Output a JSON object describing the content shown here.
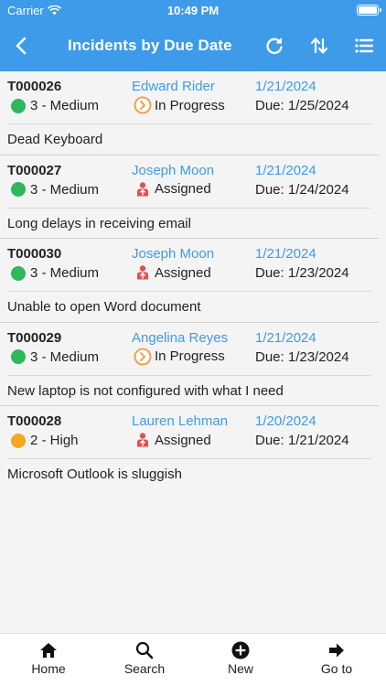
{
  "status": {
    "carrier": "Carrier",
    "time": "10:49 PM"
  },
  "header": {
    "title": "Incidents by Due Date"
  },
  "incidents": [
    {
      "number": "T000026",
      "person": "Edward Rider",
      "opened": "1/21/2024",
      "priority": "3 - Medium",
      "priority_color": "#2eb85c",
      "state": "In Progress",
      "state_icon": "progress-icon",
      "due": "Due: 1/25/2024",
      "description": "Dead Keyboard"
    },
    {
      "number": "T000027",
      "person": "Joseph Moon",
      "opened": "1/21/2024",
      "priority": "3 - Medium",
      "priority_color": "#2eb85c",
      "state": "Assigned",
      "state_icon": "assigned-icon",
      "due": "Due: 1/24/2024",
      "description": "Long delays in receiving email"
    },
    {
      "number": "T000030",
      "person": "Joseph Moon",
      "opened": "1/21/2024",
      "priority": "3 - Medium",
      "priority_color": "#2eb85c",
      "state": "Assigned",
      "state_icon": "assigned-icon",
      "due": "Due: 1/23/2024",
      "description": "Unable to open Word document"
    },
    {
      "number": "T000029",
      "person": "Angelina Reyes",
      "opened": "1/21/2024",
      "priority": "3 - Medium",
      "priority_color": "#2eb85c",
      "state": "In Progress",
      "state_icon": "progress-icon",
      "due": "Due: 1/23/2024",
      "description": "New laptop is not configured with what I need"
    },
    {
      "number": "T000028",
      "person": "Lauren Lehman",
      "opened": "1/20/2024",
      "priority": "2 - High",
      "priority_color": "#f5a623",
      "state": "Assigned",
      "state_icon": "assigned-icon",
      "due": "Due: 1/21/2024",
      "description": "Microsoft Outlook is sluggish"
    }
  ],
  "tabbar": {
    "home": "Home",
    "search": "Search",
    "new": "New",
    "goto": "Go to"
  },
  "colors": {
    "accent": "#3d9be9",
    "medium": "#2eb85c",
    "high": "#f5a623",
    "progress": "#f0a050",
    "assigned": "#e05050"
  }
}
